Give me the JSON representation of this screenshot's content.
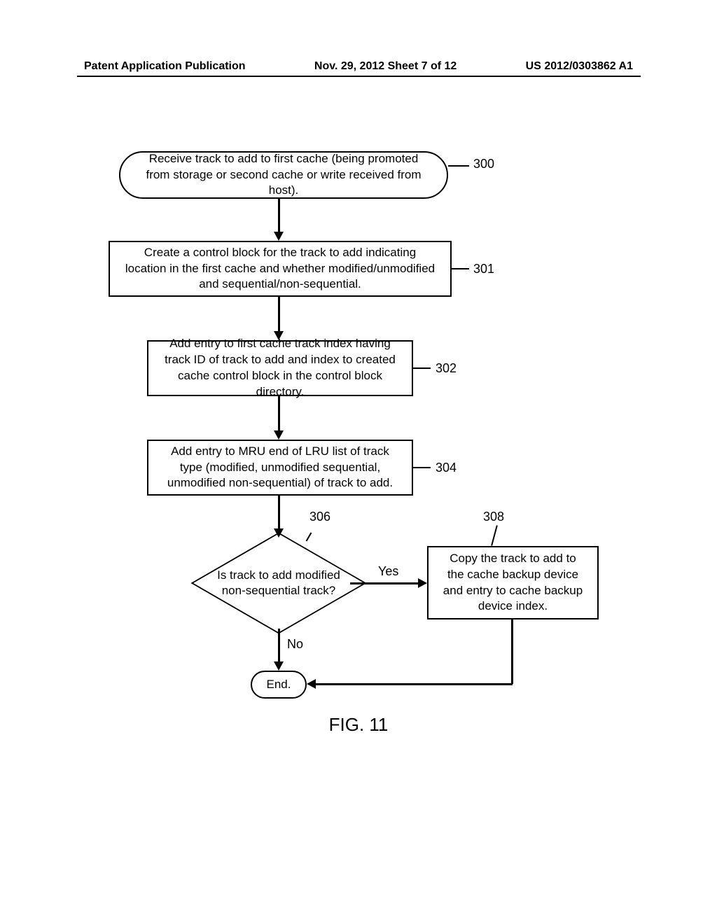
{
  "header": {
    "left": "Patent Application Publication",
    "center": "Nov. 29, 2012  Sheet 7 of 12",
    "right": "US 2012/0303862 A1"
  },
  "flowchart": {
    "step_300": {
      "text": "Receive track to add to first cache (being promoted from storage or second cache or write received from host).",
      "ref": "300"
    },
    "step_301": {
      "text": "Create a control block for the track to add indicating location in the first cache and whether modified/unmodified and sequential/non-sequential.",
      "ref": "301"
    },
    "step_302": {
      "text": "Add entry to first cache track index having track ID of track to add and index to created cache control block in the control block directory.",
      "ref": "302"
    },
    "step_304": {
      "text": "Add entry to MRU end of LRU list of track type (modified, unmodified sequential, unmodified non-sequential) of track to add.",
      "ref": "304"
    },
    "decision_306": {
      "text": "Is track to add modified non-sequential track?",
      "ref": "306",
      "yes_label": "Yes",
      "no_label": "No"
    },
    "step_308": {
      "text": "Copy the track to add to the cache backup device and entry to cache backup device index.",
      "ref": "308"
    },
    "terminal_end": {
      "text": "End."
    }
  },
  "figure_label": "FIG. 11"
}
